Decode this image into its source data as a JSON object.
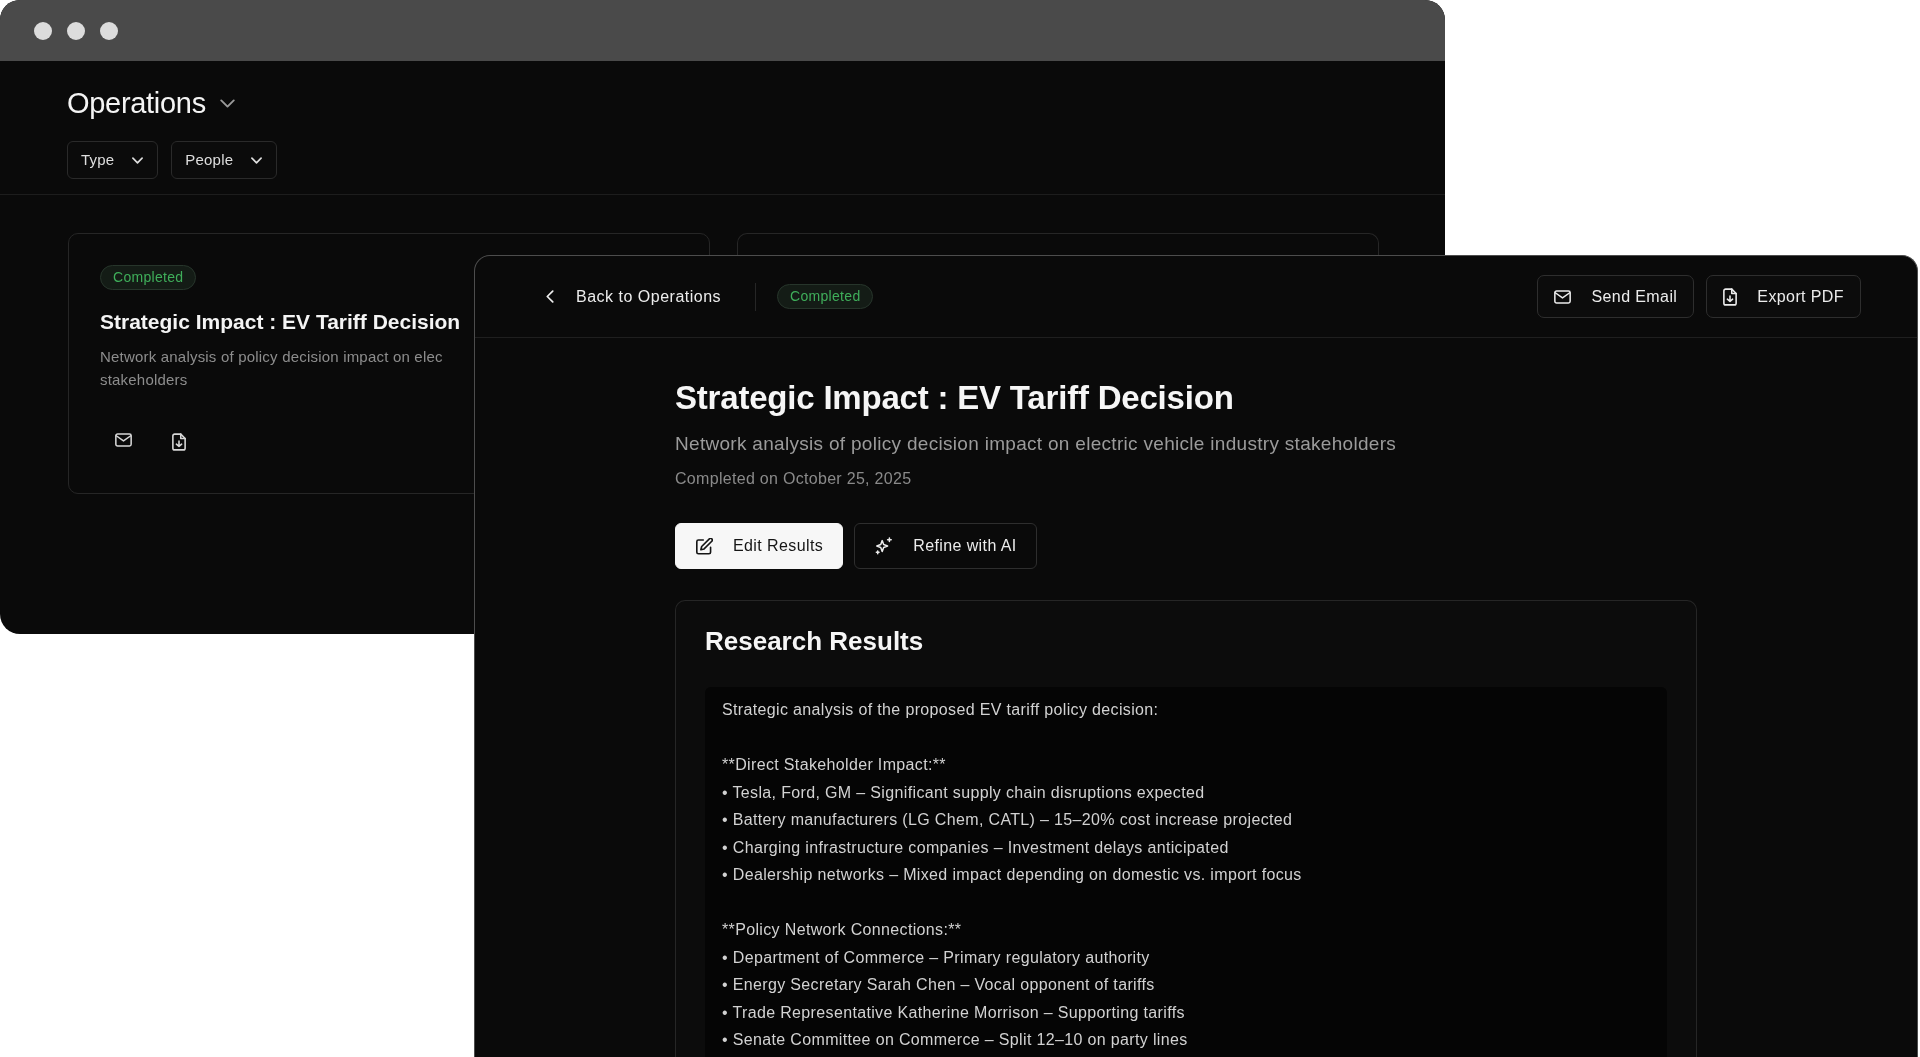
{
  "back_window": {
    "title": "Operations",
    "filters": [
      {
        "label": "Type"
      },
      {
        "label": "People"
      }
    ],
    "cards": [
      {
        "kind": "summary",
        "status": "Completed",
        "title": "Strategic Impact : EV Tariff Decision",
        "description_lines": [
          "Network analysis of policy decision impact on elec",
          "stakeholders"
        ]
      },
      {
        "kind": "covered"
      }
    ]
  },
  "front_window": {
    "back_link": "Back to Operations",
    "status": "Completed",
    "header_actions": [
      {
        "label": "Send Email"
      },
      {
        "label": "Export PDF"
      }
    ],
    "title": "Strategic Impact : EV Tariff Decision",
    "subtitle": "Network analysis of policy decision impact on electric vehicle industry stakeholders",
    "completed_date": "Completed on October 25, 2025",
    "actions": [
      {
        "label": "Edit Results",
        "kind": "primary"
      },
      {
        "label": "Refine with AI",
        "kind": "secondary"
      }
    ],
    "results": {
      "title": "Research Results",
      "blocks": [
        [
          "Strategic analysis of the proposed EV tariff policy decision:"
        ],
        [
          "**Direct Stakeholder Impact:**",
          "• Tesla, Ford, GM – Significant supply chain disruptions expected",
          "• Battery manufacturers (LG Chem, CATL) – 15–20% cost increase projected",
          "• Charging infrastructure companies – Investment delays anticipated",
          "• Dealership networks – Mixed impact depending on domestic vs. import focus"
        ],
        [
          "**Policy Network Connections:**",
          "• Department of Commerce – Primary regulatory authority",
          "• Energy Secretary Sarah Chen – Vocal opponent of tariffs",
          "• Trade Representative Katherine Morrison – Supporting tariffs",
          "• Senate Committee on Commerce – Split 12–10 on party lines"
        ]
      ]
    }
  }
}
